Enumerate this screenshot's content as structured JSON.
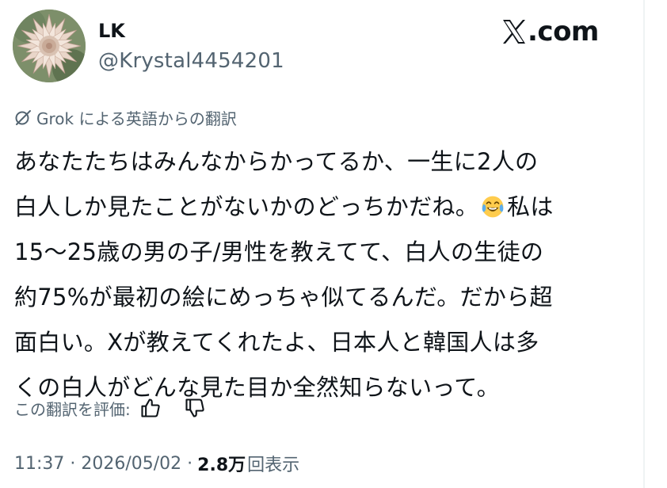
{
  "author": {
    "display_name": "LK",
    "handle": "@Krystal4454201",
    "avatar_icon": "protea-flower-avatar"
  },
  "site": {
    "logo_icon": "x-logo-icon",
    "name": ".com"
  },
  "translation": {
    "icon": "grok-icon",
    "label": "Grok による英語からの翻訳"
  },
  "tweet": {
    "lines": [
      {
        "text": "あなたたちはみんなからかってるか、一生に2人の"
      },
      {
        "text": "白人しか見たことがないかのどっちかだね。",
        "emoji": "face-with-tears-of-joy-emoji",
        "after": "私は"
      },
      {
        "text": "15〜25歳の男の子/男性を教えてて、白人の生徒の"
      },
      {
        "text": "約75%が最初の絵にめっちゃ似てるんだ。だから超"
      },
      {
        "text": "面白い。Xが教えてくれたよ、日本人と韓国人は多"
      },
      {
        "text": "くの白人がどんな見た目か全然知らないって。"
      }
    ]
  },
  "rating": {
    "label": "この翻訳を評価:",
    "thumbs_up_icon": "thumbs-up-icon",
    "thumbs_down_icon": "thumbs-down-icon"
  },
  "meta": {
    "time_date": "11:37 · 2026/05/02 ·",
    "views_count": "2.8万",
    "views_label": "回表示"
  },
  "colors": {
    "text_primary": "#0f1419",
    "text_secondary": "#536471",
    "background": "#ffffff"
  }
}
